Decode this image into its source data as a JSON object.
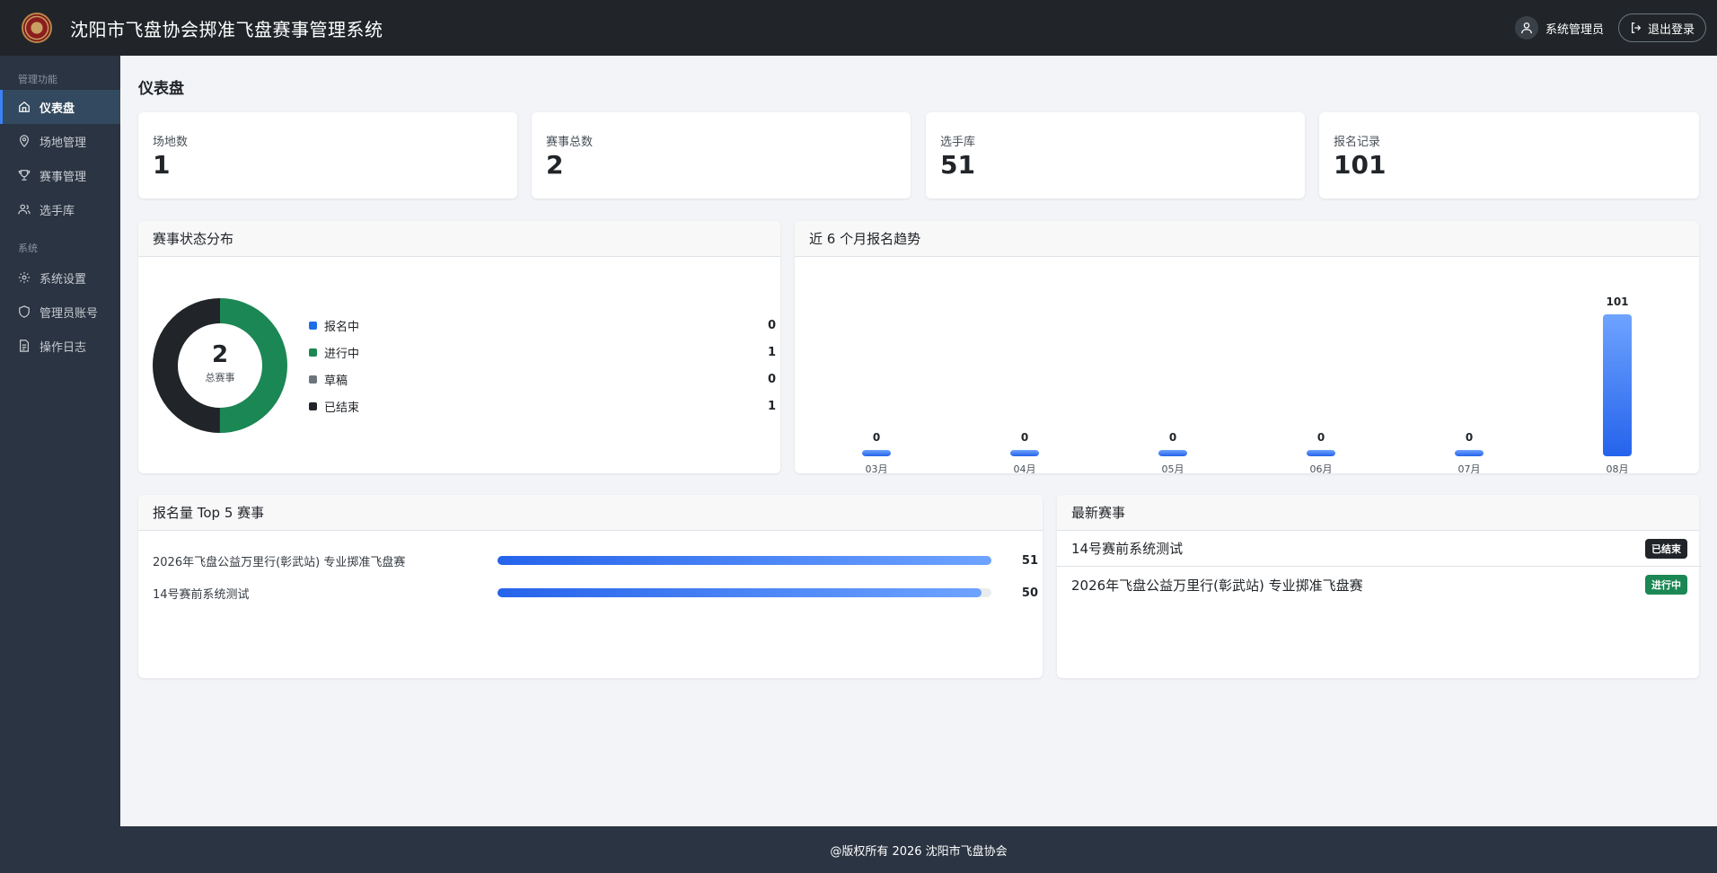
{
  "header": {
    "title": "沈阳市飞盘协会掷准飞盘赛事管理系统",
    "user_name": "系统管理员",
    "logout_label": "退出登录"
  },
  "sidebar": {
    "section1": "管理功能",
    "section2": "系统",
    "items": [
      {
        "label": "仪表盘",
        "icon": "home-icon"
      },
      {
        "label": "场地管理",
        "icon": "map-pin-icon"
      },
      {
        "label": "赛事管理",
        "icon": "trophy-icon"
      },
      {
        "label": "选手库",
        "icon": "users-icon"
      },
      {
        "label": "系统设置",
        "icon": "gear-icon"
      },
      {
        "label": "管理员账号",
        "icon": "shield-icon"
      },
      {
        "label": "操作日志",
        "icon": "document-icon"
      }
    ]
  },
  "page": {
    "title": "仪表盘"
  },
  "stats": [
    {
      "label": "场地数",
      "value": "1"
    },
    {
      "label": "赛事总数",
      "value": "2"
    },
    {
      "label": "选手库",
      "value": "51"
    },
    {
      "label": "报名记录",
      "value": "101"
    }
  ],
  "status_card": {
    "title": "赛事状态分布",
    "total": "2",
    "total_label": "总赛事",
    "legend": [
      {
        "label": "报名中",
        "value": "0",
        "color": "#1e6fe6"
      },
      {
        "label": "进行中",
        "value": "1",
        "color": "#1b8754"
      },
      {
        "label": "草稿",
        "value": "0",
        "color": "#6c757d"
      },
      {
        "label": "已结束",
        "value": "1",
        "color": "#212529"
      }
    ]
  },
  "trend_card": {
    "title": "近 6 个月报名趋势"
  },
  "chart_data": {
    "type": "bar",
    "categories": [
      "03月",
      "04月",
      "05月",
      "06月",
      "07月",
      "08月"
    ],
    "values": [
      0,
      0,
      0,
      0,
      0,
      101
    ],
    "value_labels": [
      "0",
      "0",
      "0",
      "0",
      "0",
      "101"
    ]
  },
  "top5_card": {
    "title": "报名量 Top 5 赛事",
    "rows": [
      {
        "name": "2026年飞盘公益万里行(彰武站) 专业掷准飞盘赛",
        "value": "51",
        "fraction": 1.0
      },
      {
        "name": "14号赛前系统测试",
        "value": "50",
        "fraction": 0.98
      }
    ]
  },
  "latest_card": {
    "title": "最新赛事",
    "rows": [
      {
        "name": "14号赛前系统测试",
        "status": "已结束",
        "status_color": "#212529"
      },
      {
        "name": "2026年飞盘公益万里行(彰武站) 专业掷准飞盘赛",
        "status": "进行中",
        "status_color": "#1b8754"
      }
    ]
  },
  "footer": {
    "text": "@版权所有 2026 沈阳市飞盘协会"
  }
}
